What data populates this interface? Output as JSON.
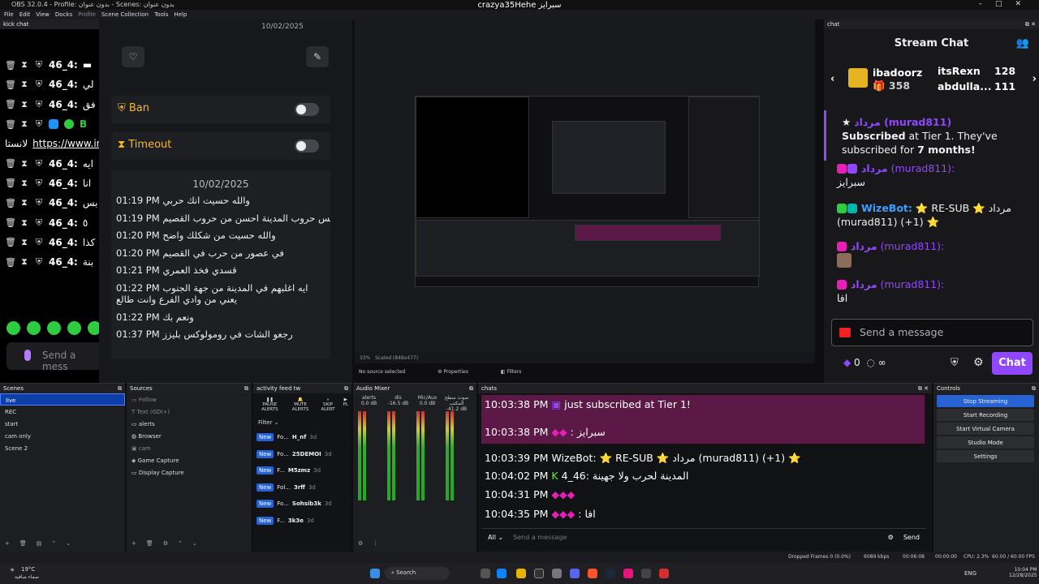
{
  "window": {
    "title": "OBS 32.0.4 - Profile: بدون عنوان - Scenes: بدون عنوان",
    "center_title": "crazya35Hehe سبرايز"
  },
  "menu": [
    "File",
    "Edit",
    "View",
    "Docks",
    "Profile",
    "Scene Collection",
    "Tools",
    "Help"
  ],
  "kick_chat": {
    "dock_title": "kick chat",
    "rows": [
      {
        "name": "46_4:",
        "extra": "▬"
      },
      {
        "name": "46_4:",
        "extra": "لي"
      },
      {
        "name": "46_4:",
        "extra": "فق"
      },
      {
        "name": "B",
        "extra": ""
      },
      {
        "name": "https://www.ins",
        "extra": "لانستا"
      },
      {
        "name": "46_4:",
        "extra": "ايه"
      },
      {
        "name": "46_4:",
        "extra": "انا"
      },
      {
        "name": "46_4:",
        "extra": "بس"
      },
      {
        "name": "46_4:",
        "extra": "٥"
      },
      {
        "name": "46_4:",
        "extra": "كذا"
      },
      {
        "name": "46_4:",
        "extra": "بنة"
      }
    ],
    "send_placeholder": "Send a mess",
    "mod": {
      "date_top": "10/02/2025",
      "ban_label": "Ban",
      "timeout_label": "Timeout",
      "history_date": "10/02/2025",
      "history": [
        {
          "time": "01:19 PM",
          "text": "والله حسيت انك حربي"
        },
        {
          "time": "01:19 PM",
          "text": "بس حروب المدينة احسن من حروب القصيم"
        },
        {
          "time": "01:20 PM",
          "text": "والله حسيت من شكلك واضح"
        },
        {
          "time": "01:20 PM",
          "text": "في عصور من حرب في القصيم"
        },
        {
          "time": "01:21 PM",
          "text": "قسدي فخذ العمري"
        },
        {
          "time": "01:22 PM",
          "text": "ايه اغلبهم في المدينة من جهة الجنوب يعني من وادي الفرع وانت طالع"
        },
        {
          "time": "01:22 PM",
          "text": "ونعم بك"
        },
        {
          "time": "01:37 PM",
          "text": "رجعو الشات في رومولوكس بليزز"
        }
      ]
    }
  },
  "preview": {
    "zoom": "33%",
    "scaled": "Scaled (848x477)"
  },
  "twitch_chat": {
    "dock_title": "chat",
    "title": "Stream Chat",
    "gifters": [
      {
        "name": "ibadoorz",
        "count": "358"
      },
      {
        "name": "itsRexn",
        "count": "128"
      },
      {
        "name": "abdulla...",
        "count": "111"
      }
    ],
    "sub_user": "مرداد (murad811)",
    "sub_text_a": "Subscribed",
    "sub_text_b": " at Tier 1. They've subscribed for ",
    "sub_months": "7 months!",
    "msg1_user": "مرداد",
    "msg1_login": "(murad811):",
    "msg1_text": "سبرايز",
    "bot_user": "WizeBot:",
    "bot_text": "⭐ RE-SUB ⭐ مرداد (murad811) (+1) ⭐",
    "msg2_user": "مرداد",
    "msg2_login": "(murad811):",
    "msg3_user": "مرداد",
    "msg3_login": "(murad811):",
    "msg3_text": "افا",
    "send_placeholder": "Send a message",
    "points": "0",
    "infinity": "∞",
    "chat_button": "Chat"
  },
  "status_line": "No source selected",
  "properties_btn": "Properties",
  "filters_btn": "Filters",
  "scenes": {
    "title": "Scenes",
    "items": [
      "live",
      "REC",
      "start",
      "cam only",
      "Scene 2"
    ],
    "selected": 0
  },
  "sources": {
    "title": "Sources",
    "items": [
      "Follow",
      "Text (GDI+)",
      "alerts",
      "Browser",
      "cam",
      "Game Capture",
      "Display Capture"
    ]
  },
  "activity": {
    "title": "activity feed tw",
    "buttons": [
      "PAUSE ALERTS",
      "MUTE ALERTS",
      "SKIP ALERT",
      "PL"
    ],
    "filter": "Filter",
    "items": [
      {
        "badge": "New",
        "kind": "Fo...",
        "name": "H_nf",
        "age": "3d"
      },
      {
        "badge": "New",
        "kind": "Fo...",
        "name": "25DEMOI",
        "age": "3d"
      },
      {
        "badge": "New",
        "kind": "F...",
        "name": "M5zmz",
        "age": "3d"
      },
      {
        "badge": "New",
        "kind": "Fol...",
        "name": "3rff",
        "age": "3d"
      },
      {
        "badge": "New",
        "kind": "Fo...",
        "name": "Sohsib3k",
        "age": "3d"
      },
      {
        "badge": "New",
        "kind": "F...",
        "name": "3k3e",
        "age": "3d"
      }
    ]
  },
  "mixer": {
    "title": "Audio Mixer",
    "channels": [
      {
        "name": "alerts",
        "db": "0.0 dB"
      },
      {
        "name": "dis",
        "db": "-16.5 dB"
      },
      {
        "name": "Mic/Aux",
        "db": "0.0 dB"
      },
      {
        "name": "صوت سطح المكتب",
        "db": "-41.2 dB"
      }
    ]
  },
  "obs_chat": {
    "title": "chats",
    "lines": [
      {
        "time": "10:03:38 PM",
        "text": "just subscribed at Tier 1!"
      },
      {
        "time": "10:03:38 PM",
        "text": ": سبرايز"
      },
      {
        "time": "10:03:39 PM",
        "text": "WizeBot: ⭐ RE-SUB ⭐ مرداد (murad811) (+1) ⭐"
      },
      {
        "time": "10:04:02 PM",
        "text": "المدينة لحرب ولا جهينة :46_4"
      },
      {
        "time": "10:04:31 PM",
        "text": ""
      },
      {
        "time": "10:04:35 PM",
        "text": ": افا"
      }
    ],
    "channel": "All",
    "placeholder": "Send a message",
    "send": "Send"
  },
  "controls": {
    "title": "Controls",
    "buttons": [
      "Stop Streaming",
      "Start Recording",
      "Start Virtual Camera",
      "Studio Mode",
      "Settings"
    ]
  },
  "status": {
    "dropped": "Dropped Frames 0 (0.0%)",
    "kbps": "6089 kbps",
    "live_time": "00:06:08",
    "rec_time": "00:00:00",
    "cpu": "CPU: 2.3%",
    "fps": "60.00 / 60.00 FPS"
  },
  "taskbar": {
    "weather": "19°C",
    "weather_sub": "سماء صافية",
    "search": "Search",
    "lang": "ENG",
    "time": "10:04 PM",
    "date": "12/28/2025"
  },
  "colors": {
    "twitch": "#9147ff",
    "kick": "#53fc18",
    "obs_blue": "#2863d4"
  }
}
